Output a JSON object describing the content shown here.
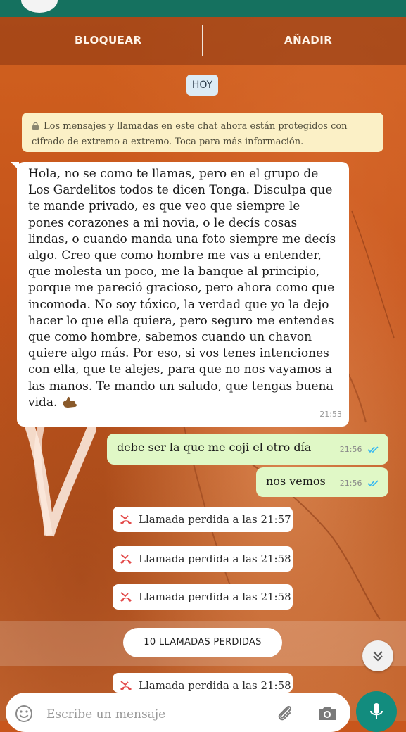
{
  "header": {
    "block_label": "BLOQUEAR",
    "add_label": "AÑADIR"
  },
  "chat": {
    "date_label": "HOY",
    "encryption_notice": "Los mensajes y llamadas en este chat ahora están protegidos con cifrado de extremo a extremo. Toca para más información.",
    "messages": [
      {
        "direction": "incoming",
        "text": "Hola, no se como te llamas, pero en el grupo de Los Gardelitos todos te dicen Tonga. Disculpa que te mande privado, es que veo que siempre le pones corazones a mi novia, o le decís cosas lindas, o cuando manda una foto siempre me decís algo. Creo que como hombre me vas a entender, que molesta un poco, me la banque al principio, porque me pareció gracioso, pero ahora como que incomoda. No soy tóxico, la verdad que yo la dejo hacer lo que ella quiera, pero seguro me entendes que como hombre, sabemos cuando un chavon quiere algo más. Por eso, si vos tenes intenciones con ella, que te alejes, para que no nos vayamos a las manos. Te mando un saludo, que tengas buena vida.",
        "time": "21:53"
      },
      {
        "direction": "outgoing",
        "text": "debe ser la que me coji el otro día",
        "time": "21:56",
        "status": "read"
      },
      {
        "direction": "outgoing",
        "text": "nos vemos",
        "time": "21:56",
        "status": "read"
      }
    ],
    "missed_calls": [
      "Llamada perdida a las 21:57",
      "Llamada perdida a las 21:58",
      "Llamada perdida a las 21:58",
      "Llamada perdida a las 21:58"
    ],
    "missed_summary": "10 LLAMADAS PERDIDAS"
  },
  "composer": {
    "placeholder": "Escribe un mensaje"
  },
  "colors": {
    "status_bar": "#15715f",
    "outgoing_bubble": "#e0f8c6",
    "incoming_bubble": "#ffffff",
    "notice_bg": "#fbf0c6",
    "date_pill_bg": "#dcebf5",
    "read_ticks": "#34b7f1",
    "missed_call_icon": "#e34b4b",
    "mic_button": "#128c7e"
  },
  "icons": {
    "lock": "lock-icon",
    "missed_call": "missed-call-icon",
    "read_ticks": "double-check-icon",
    "scroll_down": "chevron-double-down-icon",
    "emoji": "emoji-icon",
    "attach": "paperclip-icon",
    "camera": "camera-icon",
    "mic": "microphone-icon",
    "hand_emoji": "call-me-hand-emoji"
  }
}
